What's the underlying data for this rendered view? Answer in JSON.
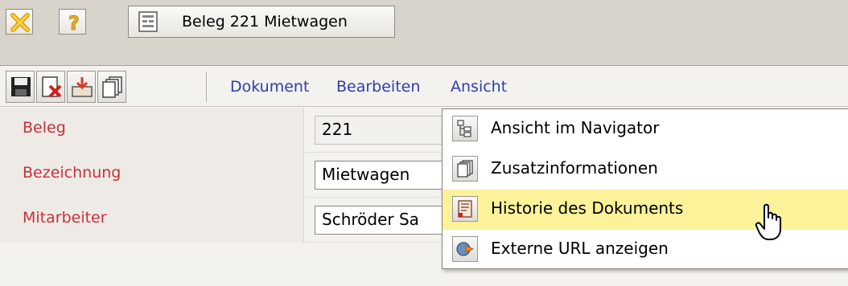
{
  "window": {
    "close_icon": "close-x-icon",
    "help_icon": "question-mark-icon",
    "document_tab": {
      "icon": "document-form-icon",
      "label": "Beleg 221 Mietwagen"
    }
  },
  "toolbar": {
    "buttons": [
      {
        "icon": "save-floppy-icon"
      },
      {
        "icon": "delete-document-icon"
      },
      {
        "icon": "inbox-download-icon"
      },
      {
        "icon": "copy-pages-icon"
      }
    ],
    "menus": [
      "Dokument",
      "Bearbeiten",
      "Ansicht"
    ]
  },
  "form": {
    "rows": [
      {
        "label": "Beleg",
        "value": "221"
      },
      {
        "label": "Bezeichnung",
        "value": "Mietwagen"
      },
      {
        "label": "Mitarbeiter",
        "value": "Schröder Sa"
      }
    ]
  },
  "dropdown": {
    "items": [
      {
        "label": "Ansicht im Navigator",
        "icon": "tree-structure-icon"
      },
      {
        "label": "Zusatzinformationen",
        "icon": "copy-pages-icon"
      },
      {
        "label": "Historie des Dokuments",
        "icon": "document-history-icon",
        "highlighted": true
      },
      {
        "label": "Externe URL anzeigen",
        "icon": "globe-arrow-icon"
      }
    ]
  },
  "colors": {
    "label_red": "#c9303a",
    "menu_blue": "#2a3fb0",
    "highlight_yellow": "#fbf29a"
  }
}
